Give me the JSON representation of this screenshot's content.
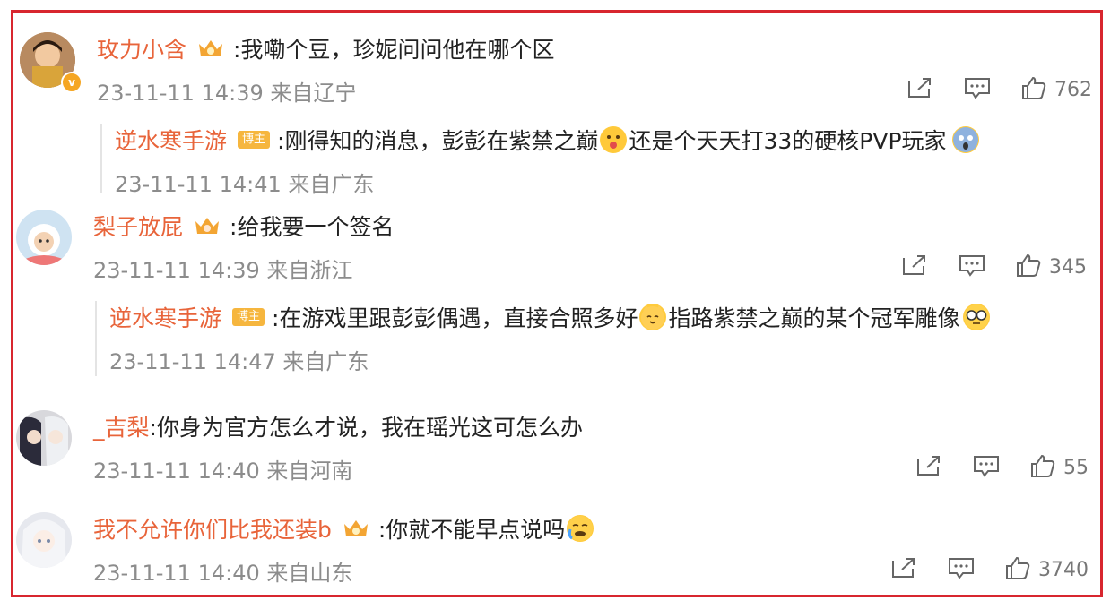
{
  "comments": [
    {
      "user": "玫力小含",
      "text": ":我嘞个豆，珍妮问问他在哪个区",
      "meta": "23-11-11 14:39 来自辽宁",
      "likes": "762",
      "reply": {
        "user": "逆水寒手游",
        "tag": "博主",
        "text1": ":刚得知的消息，彭彭在紫禁之巅",
        "text2": "还是个天天打33的硬核PVP玩家",
        "meta": "23-11-11 14:41 来自广东"
      }
    },
    {
      "user": "梨子放屁",
      "text": ":给我要一个签名",
      "meta": "23-11-11 14:39 来自浙江",
      "likes": "345",
      "reply": {
        "user": "逆水寒手游",
        "tag": "博主",
        "text1": ":在游戏里跟彭彭偶遇，直接合照多好",
        "text2": "指路紫禁之巅的某个冠军雕像",
        "meta": "23-11-11 14:47 来自广东"
      }
    },
    {
      "user": "_吉梨",
      "text": ":你身为官方怎么才说，我在瑶光这可怎么办",
      "meta": "23-11-11 14:40 来自河南",
      "likes": "55"
    },
    {
      "user": "我不允许你们比我还装b",
      "text": ":你就不能早点说吗",
      "meta": "23-11-11 14:40 来自山东",
      "likes": "3740"
    }
  ],
  "icons": {
    "share": "share-icon",
    "comment": "comment-icon",
    "like": "thumbs-up-icon",
    "crown": "crown-badge-icon",
    "verified": "verified-badge-icon"
  },
  "colors": {
    "frame": "#d8262f",
    "username": "#e8643a",
    "meta": "#8c8c8c",
    "blogger_tag": "#f6b63e"
  },
  "badges": {
    "verified": "v"
  }
}
